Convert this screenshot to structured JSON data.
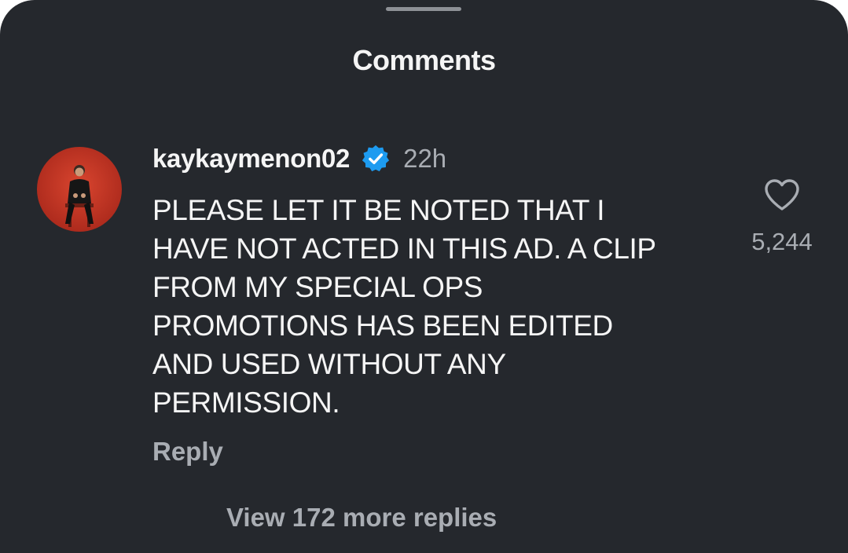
{
  "sheet": {
    "title": "Comments"
  },
  "comment": {
    "avatar_icon": "profile-avatar-person-on-red",
    "username": "kaykaymenon02",
    "verified_icon": "verified-badge-icon",
    "time": "22h",
    "text_lines": [
      "PLEASE LET IT BE NOTED THAT I",
      "HAVE NOT ACTED IN THIS AD. A CLIP",
      "FROM MY SPECIAL OPS",
      "PROMOTIONS HAS BEEN EDITED",
      "AND USED WITHOUT ANY",
      "PERMISSION."
    ],
    "reply_label": "Reply",
    "like_icon": "heart-outline-icon",
    "like_count": "5,244",
    "view_replies_label": "View 172 more replies"
  },
  "colors": {
    "background": "#25282d",
    "primary_text": "#f5f5f5",
    "secondary_text": "#a9adb3",
    "verified_blue": "#1d9bf0",
    "avatar_red": "#c0392b"
  }
}
